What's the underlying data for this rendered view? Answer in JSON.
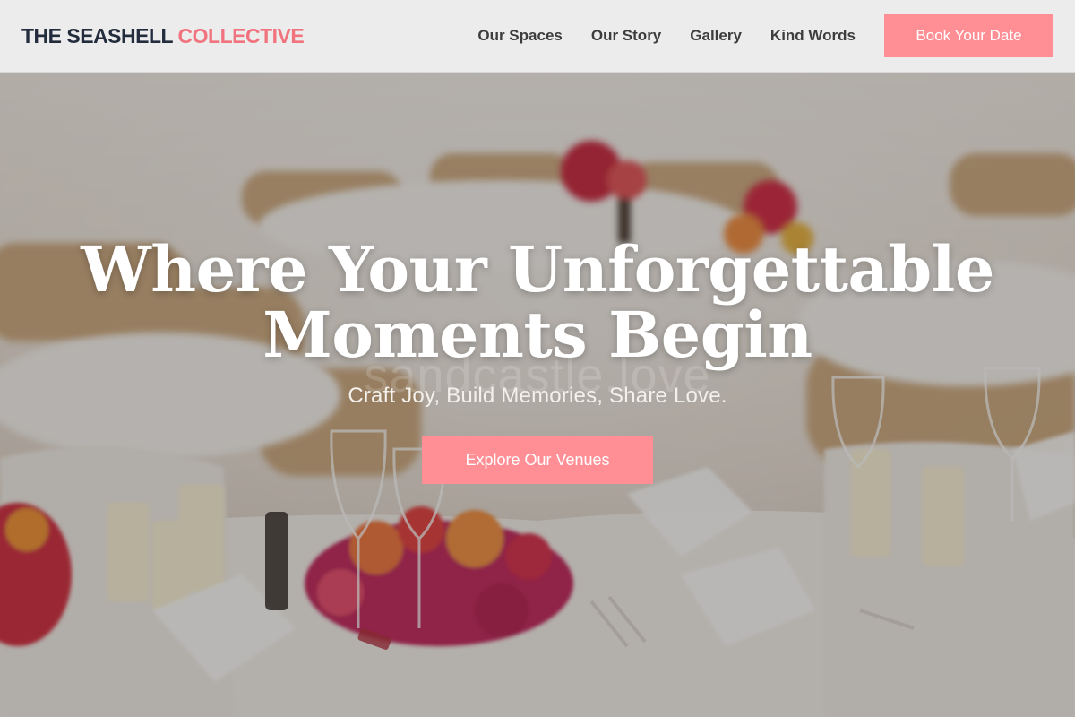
{
  "brand": {
    "name_main": "THE SEASHELL",
    "name_accent": "COLLECTIVE"
  },
  "nav": {
    "items": [
      {
        "label": "Our Spaces"
      },
      {
        "label": "Our Story"
      },
      {
        "label": "Gallery"
      },
      {
        "label": "Kind Words"
      }
    ],
    "cta_label": "Book Your Date"
  },
  "hero": {
    "title_line1": "Where Your Unforgettable",
    "title_line2": "Moments Begin",
    "watermark": "sandcastle.love",
    "subtitle": "Craft Joy, Build Memories, Share Love.",
    "cta_label": "Explore Our Venues",
    "background_image": "wedding-reception-table-with-flowers-and-glasses"
  },
  "colors": {
    "accent": "#f0737e",
    "button": "#ff8e95",
    "header_bg": "#ececec",
    "logo_dark": "#232c3d"
  }
}
